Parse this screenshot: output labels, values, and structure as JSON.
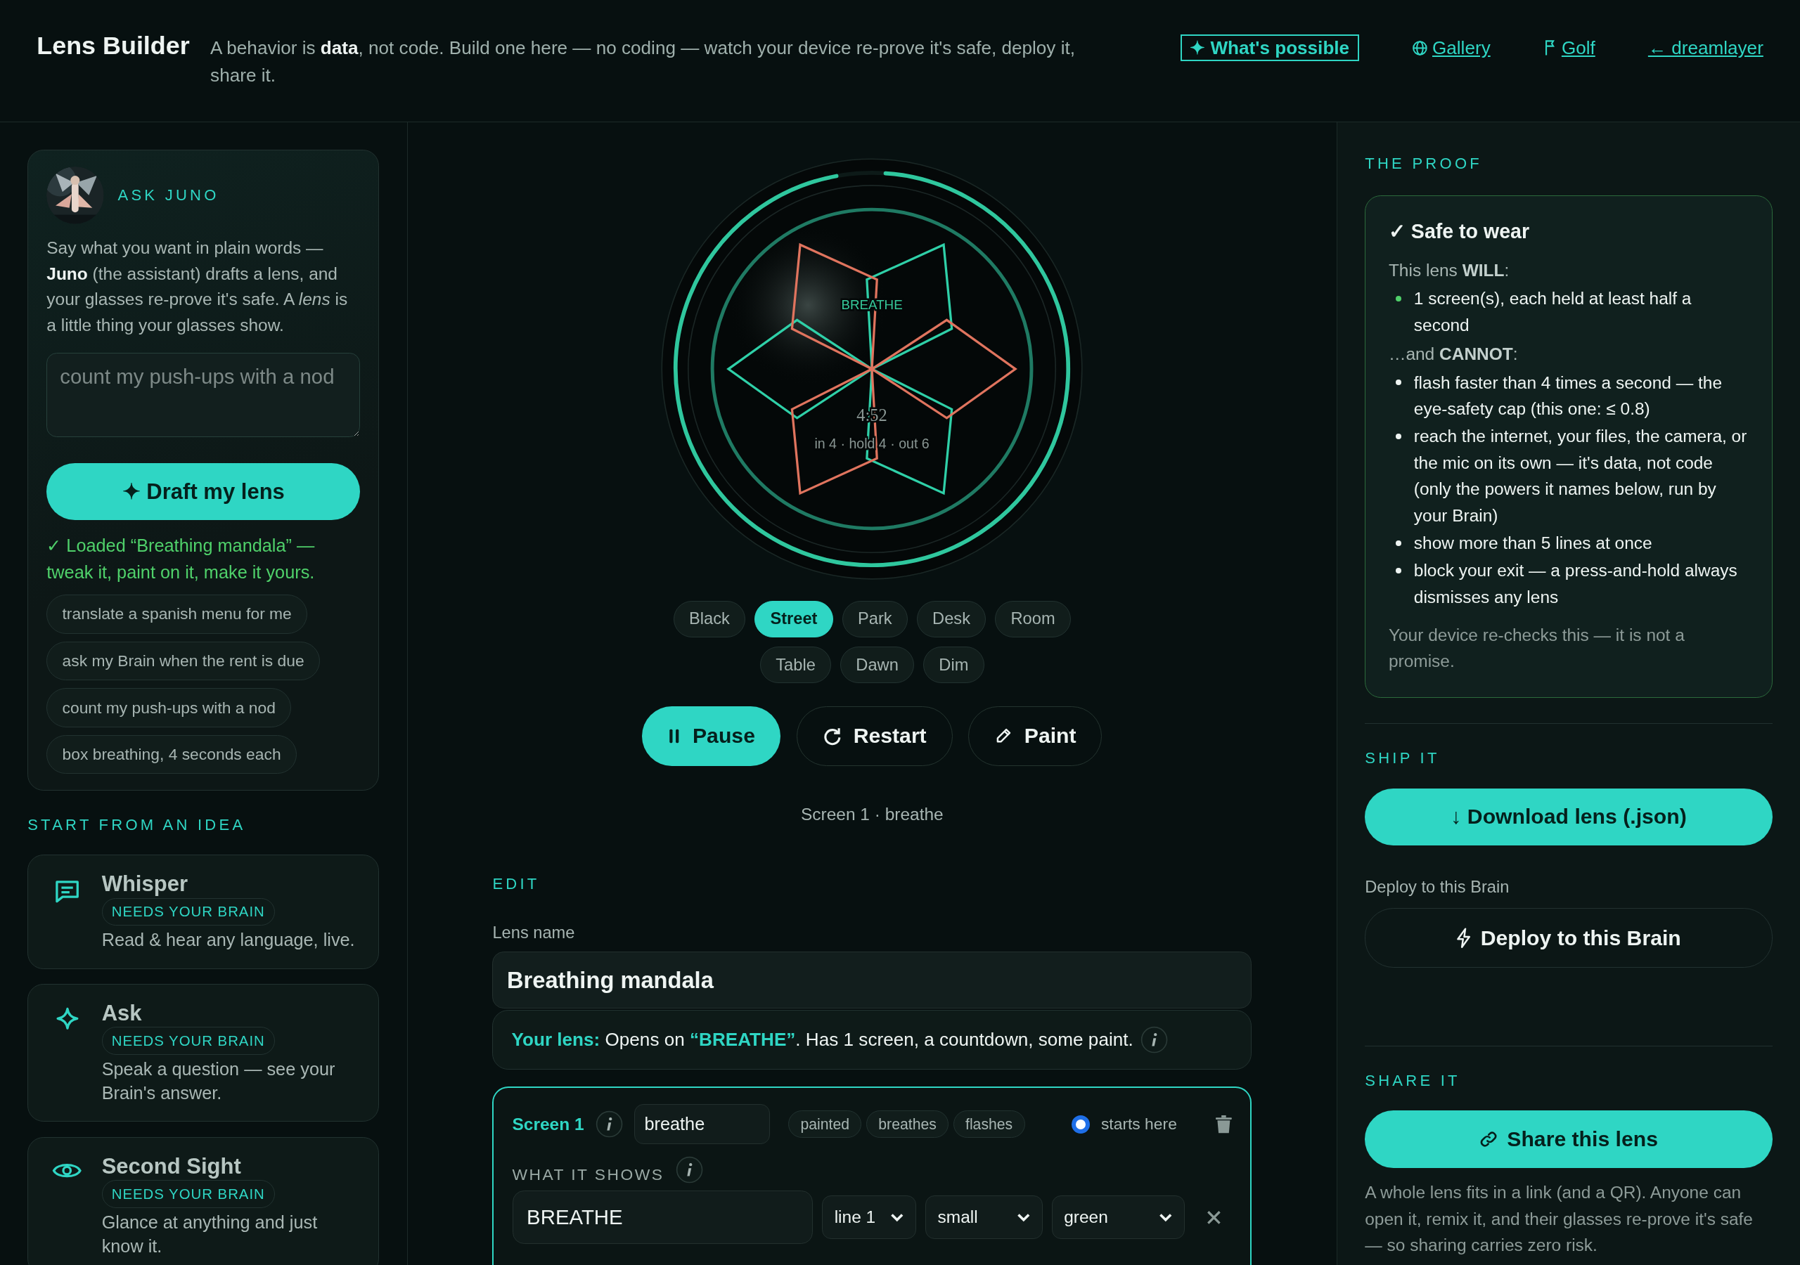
{
  "header": {
    "title": "Lens Builder",
    "tagline": "A behavior is **data**, not code. Build one here — no coding — watch your device re-prove it's safe, deploy it, share it.",
    "links": [
      {
        "kind": "feature",
        "label": "✦ What's possible"
      },
      {
        "kind": "globe",
        "label": "Gallery"
      },
      {
        "kind": "flag",
        "label": "Golf"
      },
      {
        "kind": "plain",
        "label": "← dreamlayer"
      }
    ]
  },
  "assistant": {
    "heading": "ASK JUNO",
    "intro": "Say what you want in plain words — **Juno** (the assistant) drafts a lens, and your glasses re-prove it's safe. A *lens* is a little thing your glasses show.",
    "prompt": {
      "placeholder": "count my push-ups with a nod"
    },
    "draft_button": "✦ Draft my lens",
    "status": "✓ Loaded “Breathing mandala” — tweak it, paint on it, make it yours.",
    "suggestions": [
      "translate a spanish menu for me",
      "ask my Brain when the rent is due",
      "count my push-ups with a nod",
      "box breathing, 4 seconds each"
    ]
  },
  "ideas": {
    "heading": "START FROM AN IDEA",
    "items": [
      {
        "kind": "chat",
        "title": "Whisper",
        "badge": "NEEDS YOUR BRAIN",
        "description": "Read & hear any language, live."
      },
      {
        "kind": "sparkle",
        "title": "Ask",
        "badge": "NEEDS YOUR BRAIN",
        "description": "Speak a question — see your Brain's answer."
      },
      {
        "kind": "eye",
        "title": "Second Sight",
        "badge": "NEEDS YOUR BRAIN",
        "description": "Glance at anything and just know it."
      }
    ]
  },
  "preview": {
    "label": "BREATHE",
    "timer": "4:52",
    "pattern": "in 4 · hold 4 · out 6",
    "countdown": {
      "level": 0.96
    }
  },
  "backdrops": [
    {
      "label": "Black",
      "selected": false
    },
    {
      "label": "Street",
      "selected": true
    },
    {
      "label": "Park",
      "selected": false
    },
    {
      "label": "Desk",
      "selected": false
    },
    {
      "label": "Room",
      "selected": false
    },
    {
      "label": "Table",
      "selected": false
    },
    {
      "label": "Dawn",
      "selected": false
    },
    {
      "label": "Dim",
      "selected": false
    }
  ],
  "controls": [
    {
      "kind": "pause",
      "label": "Pause",
      "primary": true
    },
    {
      "kind": "restart",
      "label": "Restart",
      "primary": false
    },
    {
      "kind": "paint",
      "label": "Paint",
      "primary": false
    }
  ],
  "caption": "Screen 1 · breathe",
  "editor": {
    "heading": "EDIT",
    "name_label": "Lens name",
    "name": "Breathing mandala",
    "summary": "**Your lens:** Opens on **“BREATHE”**. Has 1 screen, a countdown, some paint.",
    "screens": [
      {
        "title": "Screen 1",
        "name": "breathe",
        "tags": [
          "painted",
          "breathes",
          "flashes"
        ],
        "start_label": "starts here",
        "starts_here": true,
        "shows_heading": "WHAT IT SHOWS",
        "lines": [
          {
            "text": "BREATHE",
            "line": "line 1",
            "size": "small",
            "tint": "green"
          }
        ]
      }
    ]
  },
  "proof": {
    "heading": "THE PROOF",
    "verdict": "✓ Safe to wear",
    "will_intro": "This lens **WILL**:",
    "will": [
      "1 screen(s), each held at least half a second"
    ],
    "cannot_intro": "…and **CANNOT**:",
    "cannot": [
      "flash faster than 4 times a second — the eye-safety cap (this one: ≤ 0.8)",
      "reach the internet, your files, the camera, or the mic on its own — it's data, not code (only the powers it names below, run by your Brain)",
      "show more than 5 lines at once",
      "block your exit — a press-and-hold always dismisses any lens"
    ],
    "note": "Your device re-checks this — it is not a promise."
  },
  "ship": {
    "heading": "SHIP IT",
    "download_button": "↓ Download lens (.json)",
    "deploy_label": "Deploy to this Brain",
    "deploy_button": "Deploy to this Brain"
  },
  "share": {
    "heading": "SHARE IT",
    "button": "Share this lens",
    "note": "A whole lens fits in a link (and a QR). Anyone can open it, remix it, and their glasses re-prove it's safe — so sharing carries zero risk."
  }
}
